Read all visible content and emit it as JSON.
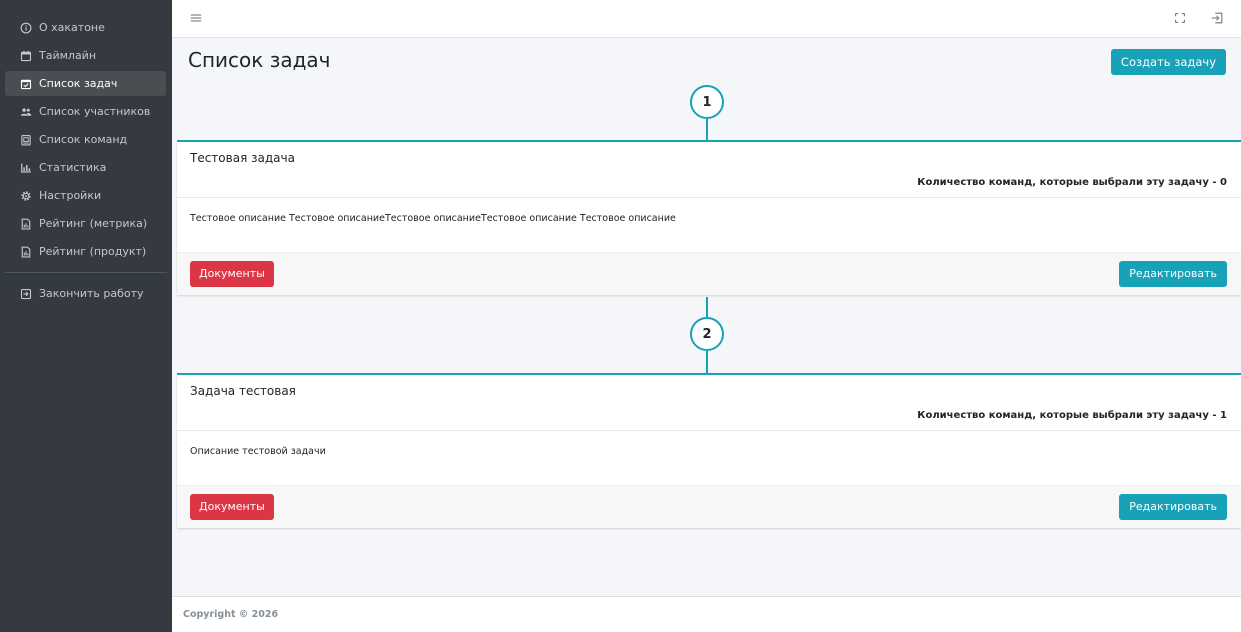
{
  "sidebar": {
    "items": [
      {
        "label": "О хакатоне",
        "icon": "info-circle-icon"
      },
      {
        "label": "Таймлайн",
        "icon": "calendar-icon"
      },
      {
        "label": "Список задач",
        "icon": "calendar-check-icon",
        "active": true
      },
      {
        "label": "Список участников",
        "icon": "users-icon"
      },
      {
        "label": "Список команд",
        "icon": "clipboard-list-icon"
      },
      {
        "label": "Статистика",
        "icon": "bar-chart-icon"
      },
      {
        "label": "Настройки",
        "icon": "gear-icon"
      },
      {
        "label": "Рейтинг (метрика)",
        "icon": "file-chart-icon"
      },
      {
        "label": "Рейтинг (продукт)",
        "icon": "file-chart-icon"
      }
    ],
    "logout_label": "Закончить работу"
  },
  "topbar": {
    "menu_icon": "hamburger-icon",
    "fullscreen_icon": "fullscreen-icon",
    "logout_icon": "sign-out-icon"
  },
  "page": {
    "title": "Список задач",
    "create_button": "Создать задачу"
  },
  "tasks": [
    {
      "number": "1",
      "title": "Тестовая задача",
      "count_text": "Количество команд, которые выбрали эту задачу - 0",
      "description": "Тестовое описание Тестовое описаниеТестовое описаниеТестовое описание Тестовое описание",
      "docs_button": "Документы",
      "edit_button": "Редактировать"
    },
    {
      "number": "2",
      "title": "Задача тестовая",
      "count_text": "Количество команд, которые выбрали эту задачу - 1",
      "description": "Описание тестовой задачи",
      "docs_button": "Документы",
      "edit_button": "Редактировать"
    }
  ],
  "footer": {
    "copyright": "Copyright © 2026"
  },
  "colors": {
    "sidebar_bg": "#343a40",
    "accent": "#17a2b8",
    "danger": "#dc3545"
  }
}
